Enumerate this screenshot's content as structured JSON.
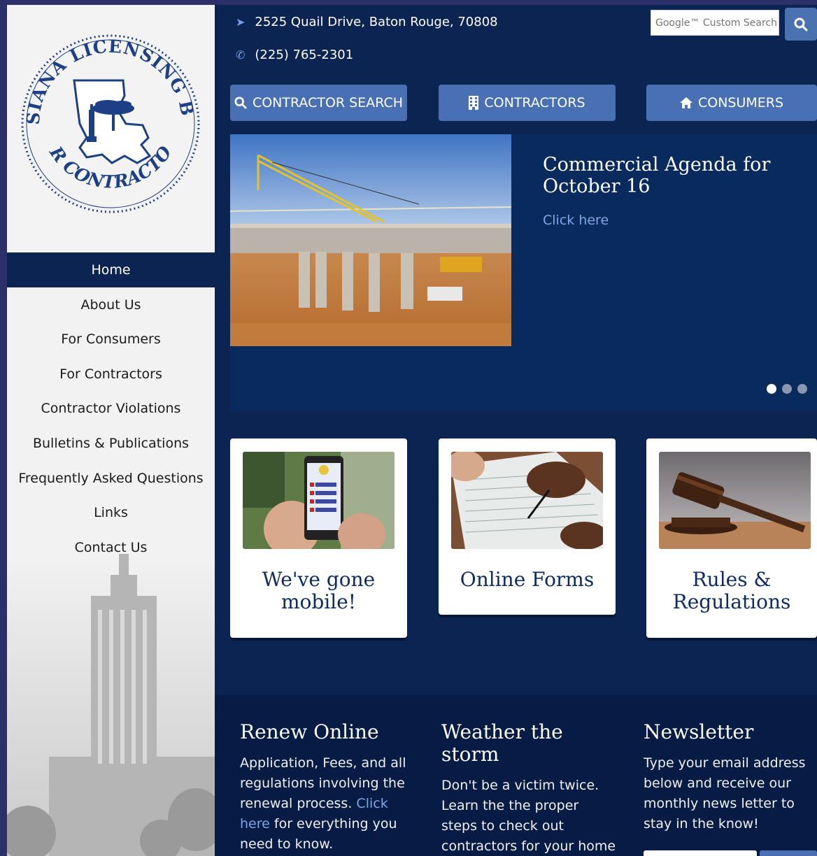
{
  "topbar": {
    "address": "2525 Quail Drive, Baton Rouge, 70808",
    "phone": "(225) 765-2301",
    "search_placeholder": "Google™ Custom Search"
  },
  "logo": {
    "text_top": "LOUISIANA LICENSING BOARD",
    "text_bottom": "FOR CONTRACTORS"
  },
  "nav": {
    "items": [
      {
        "label": "Home"
      },
      {
        "label": "About Us"
      },
      {
        "label": "For Consumers"
      },
      {
        "label": "For Contractors"
      },
      {
        "label": "Contractor Violations"
      },
      {
        "label": "Bulletins & Publications"
      },
      {
        "label": "Frequently Asked Questions"
      },
      {
        "label": "Links"
      },
      {
        "label": "Contact Us"
      }
    ]
  },
  "cta": {
    "search": "CONTRACTOR SEARCH",
    "contractors": "CONTRACTORS",
    "consumers": "CONSUMERS"
  },
  "slider": {
    "title": "Commercial Agenda for October 16",
    "link": "Click here",
    "slide_count": 3,
    "active_index": 0
  },
  "cards": [
    {
      "title": "We've gone mobile!"
    },
    {
      "title": "Online Forms"
    },
    {
      "title": "Rules & Regulations"
    }
  ],
  "footer": {
    "renew": {
      "heading": "Renew Online",
      "text_before": "Application, Fees, and all regulations involving the renewal process.",
      "link": "Click here",
      "text_after": "for everything you need to know."
    },
    "weather": {
      "heading": "Weather the storm",
      "text": "Don't be a victim twice. Learn the the proper steps to check out contractors for your home repairs."
    },
    "newsletter": {
      "heading": "Newsletter",
      "text": "Type your email address below and receive our monthly news letter to stay in the know!"
    }
  },
  "colors": {
    "navy": "#0b2452",
    "button_blue": "#4870b3",
    "link_blue": "#7ea5e6"
  }
}
